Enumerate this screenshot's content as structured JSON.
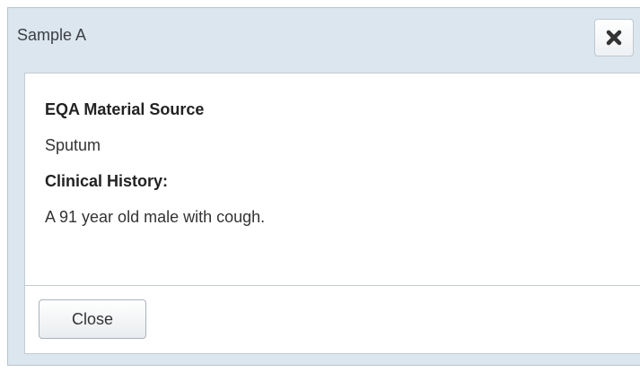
{
  "dialog": {
    "title": "Sample A",
    "close_icon": "close-x-icon"
  },
  "content": {
    "material_source_label": "EQA Material Source",
    "material_source_value": "Sputum",
    "clinical_history_label": "Clinical History:",
    "clinical_history_value": "A 91 year old male with cough."
  },
  "footer": {
    "close_label": "Close"
  },
  "colors": {
    "titlebar_bg": "#dce6ee",
    "panel_bg": "#ffffff",
    "border": "#c3ccd4"
  }
}
